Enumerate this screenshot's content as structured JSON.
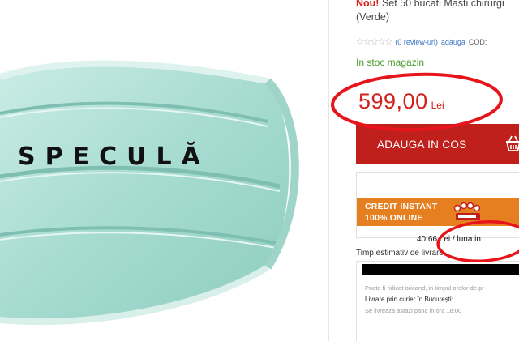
{
  "image": {
    "overlay_word": "SPECULĂ",
    "mask_color": "#a8dcd2"
  },
  "product": {
    "title_prefix": "Nou!",
    "title_line1": "Set 50 bucati Masti chirurgi",
    "title_line2": "(Verde)",
    "stars_icon": "empty-star-icons",
    "reviews": "(0 review-uri)",
    "add_review": "adauga",
    "code_label": "COD:",
    "stock": "In stoc magazin"
  },
  "price": {
    "amount": "599,00",
    "currency": "Lei"
  },
  "add_to_cart": {
    "label": "ADAUGA IN COS",
    "icon": "shopping-basket-icon"
  },
  "credit": {
    "line1": "CREDIT INSTANT",
    "line2": "100% ONLINE",
    "monthly": "40,66 Lei / luna in"
  },
  "delivery": {
    "title": "Timp estimativ de livrare",
    "pickup_note": "Poate fi ridicat oricand, in timpul orelor de pr",
    "courier": "Livrare prin curier în București:",
    "today": "Se livreaza astazi pana in ora 18:00"
  },
  "colors": {
    "red": "#d4201a",
    "button_red": "#c0201c",
    "green": "#4b9c2d",
    "orange": "#e57f20",
    "annotation_red": "#e8141b"
  }
}
